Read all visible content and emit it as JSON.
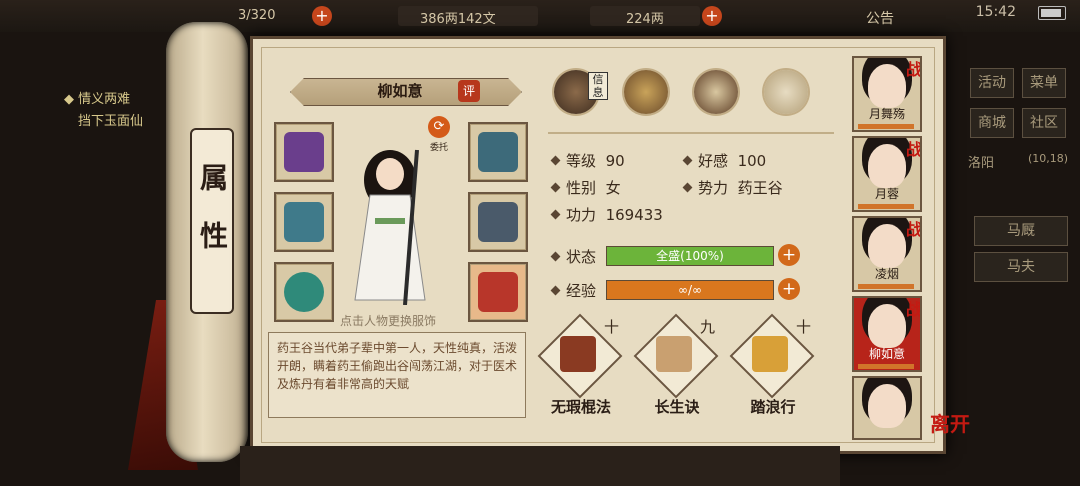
{
  "topbar": {
    "inventory": "3/320",
    "copper": "386两142文",
    "gold": "224两",
    "notice": "公告",
    "time": "15:42"
  },
  "background": {
    "quest_title": "情义两难",
    "quest_text": "挡下玉面仙",
    "right_menu": [
      "活动",
      "菜单",
      "商城",
      "社区"
    ],
    "location": "洛阳",
    "coords": "(10,18)",
    "right_buttons": [
      "马厩",
      "马夫"
    ]
  },
  "scroll": {
    "label": "属性"
  },
  "character": {
    "name": "柳如意",
    "rate_label": "评",
    "swap_label": "委托",
    "hint": "点击人物更换服饰",
    "description": "药王谷当代弟子辈中第一人，天性纯真，活泼开朗，瞒着药王偷跑出谷闯荡江湖，对于医术及炼丹有着非常高的天赋",
    "skill_tag": "信息",
    "stats": {
      "level_label": "等级",
      "level": "90",
      "affection_label": "好感",
      "affection": "100",
      "gender_label": "性别",
      "gender": "女",
      "faction_label": "势力",
      "faction": "药王谷",
      "power_label": "功力",
      "power": "169433"
    },
    "status_label": "状态",
    "status_value": "全盛(100%)",
    "status_fill": 1.0,
    "exp_label": "经验",
    "exp_value": "∞/∞",
    "exp_fill": 1.0
  },
  "skills": [
    {
      "name": "无瑕棍法",
      "level": "十"
    },
    {
      "name": "长生诀",
      "level": "九"
    },
    {
      "name": "踏浪行",
      "level": "十"
    }
  ],
  "party": [
    {
      "name": "月舞殇",
      "war": "战"
    },
    {
      "name": "月蓉",
      "war": "战"
    },
    {
      "name": "凌烟",
      "war": "战"
    },
    {
      "name": "柳如意",
      "war": "战"
    },
    {
      "name": "",
      "war": ""
    }
  ],
  "leave_label": "离开",
  "colors": {
    "status_bar": "#6cb43a",
    "exp_bar": "#d9771e",
    "accent": "#c41a12"
  }
}
